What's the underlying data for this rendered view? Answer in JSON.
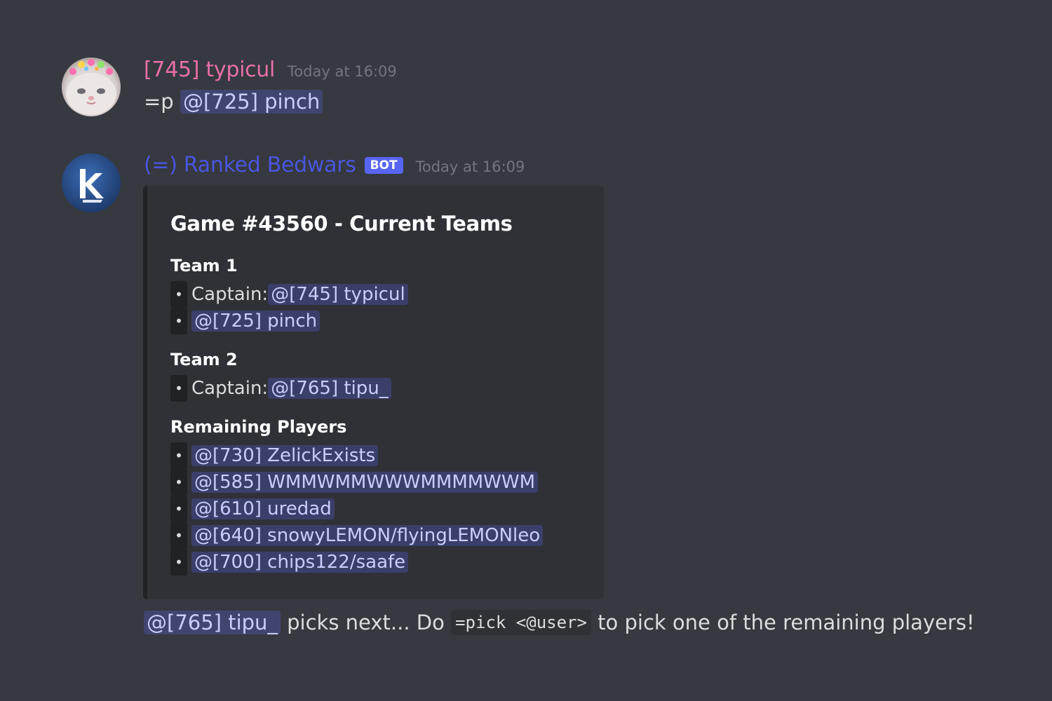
{
  "messages": [
    {
      "author": "[745] typicul",
      "author_color": "#e86fa8",
      "timestamp": "Today at 16:09",
      "prefix": "=p",
      "mention": "@[725] pinch"
    },
    {
      "author": "(=) Ranked Bedwars",
      "author_color": "#4a55e0",
      "bot_tag": "BOT",
      "timestamp": "Today at 16:09",
      "embed": {
        "title": "Game #43560 - Current Teams",
        "fields": [
          {
            "name": "Team 1",
            "lines": [
              {
                "prefix": "Captain: ",
                "mention": "@[745] typicul"
              },
              {
                "prefix": "",
                "mention": "@[725] pinch"
              }
            ]
          },
          {
            "name": "Team 2",
            "lines": [
              {
                "prefix": "Captain: ",
                "mention": "@[765] tipu_"
              }
            ]
          },
          {
            "name": "Remaining Players",
            "lines": [
              {
                "prefix": "",
                "mention": "@[730] ZelickExists"
              },
              {
                "prefix": "",
                "mention": "@[585] WMMWMMWWWMMMMWWM"
              },
              {
                "prefix": "",
                "mention": "@[610] uredad"
              },
              {
                "prefix": "",
                "mention": "@[640] snowyLEMON/flyingLEMONleo"
              },
              {
                "prefix": "",
                "mention": "@[700] chips122/saafe"
              }
            ]
          }
        ]
      },
      "footer": {
        "mention": "@[765] tipu_",
        "text_before_code": " picks next... Do ",
        "code": "=pick <@user>",
        "text_after_code": " to pick one of the remaining players!"
      }
    }
  ],
  "bullet_glyph": "•",
  "colors": {
    "background": "#36393f",
    "embed_background": "#2f3136",
    "mention_text": "#c9cdfb",
    "timestamp": "#72767d",
    "bot_tag": "#5865f2"
  }
}
